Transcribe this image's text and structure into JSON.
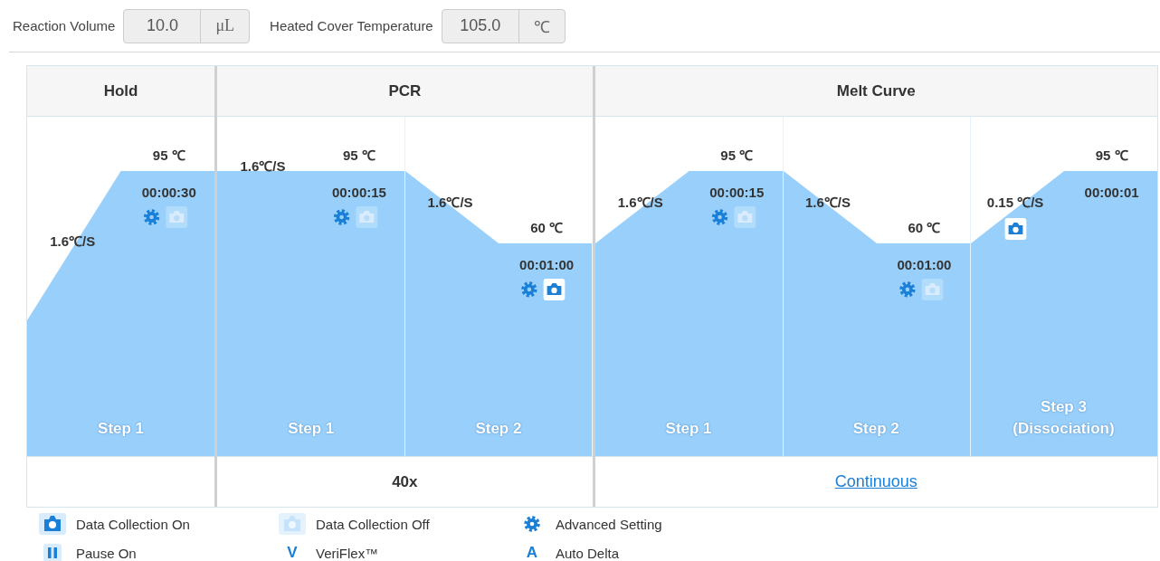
{
  "settings": [
    {
      "label": "Reaction Volume",
      "value": "10.0",
      "unit": "μL"
    },
    {
      "label": "Heated Cover Temperature",
      "value": "105.0",
      "unit": "℃"
    }
  ],
  "stages": [
    {
      "title": "Hold",
      "steps": [
        {
          "kind": "standard",
          "label": "Step 1",
          "temperature": "95 ℃",
          "time": "00:00:30",
          "rate": "1.6℃/S",
          "level": 0.84,
          "advanced_setting": true,
          "data_collection": false
        }
      ]
    },
    {
      "title": "PCR",
      "footer": {
        "text": "40x",
        "link": false
      },
      "steps": [
        {
          "kind": "standard",
          "label": "Step 1",
          "temperature": "95 ℃",
          "time": "00:00:15",
          "rate": "1.6℃/S",
          "level": 0.84,
          "advanced_setting": true,
          "data_collection": false
        },
        {
          "kind": "standard",
          "label": "Step 2",
          "temperature": "60 ℃",
          "time": "00:01:00",
          "rate": "1.6℃/S",
          "level": 0.627,
          "advanced_setting": true,
          "data_collection": true
        }
      ]
    },
    {
      "title": "Melt Curve",
      "footer": {
        "text": "Continuous",
        "link": true
      },
      "steps": [
        {
          "kind": "standard",
          "label": "Step 1",
          "temperature": "95 ℃",
          "time": "00:00:15",
          "rate": "1.6℃/S",
          "level": 0.84,
          "advanced_setting": true,
          "data_collection": false
        },
        {
          "kind": "standard",
          "label": "Step 2",
          "temperature": "60 ℃",
          "time": "00:01:00",
          "rate": "1.6℃/S",
          "level": 0.627,
          "advanced_setting": true,
          "data_collection": false
        },
        {
          "kind": "dissociation",
          "label": "Step 3 (Dissociation)",
          "temperature": "95 ℃",
          "time": "00:00:01",
          "rate": "0.15 ℃/S",
          "level": 0.84,
          "advanced_setting": false,
          "data_collection": true
        }
      ]
    }
  ],
  "legend": [
    {
      "kind": "camera_on",
      "label": "Data Collection On"
    },
    {
      "kind": "camera_off",
      "label": "Data Collection Off"
    },
    {
      "kind": "gear",
      "label": "Advanced Setting"
    },
    {
      "kind": "pause",
      "label": "Pause On"
    },
    {
      "kind": "glyph",
      "glyph": "V",
      "label": "VeriFlex™"
    },
    {
      "kind": "glyph",
      "glyph": "A",
      "label": "Auto Delta"
    }
  ]
}
